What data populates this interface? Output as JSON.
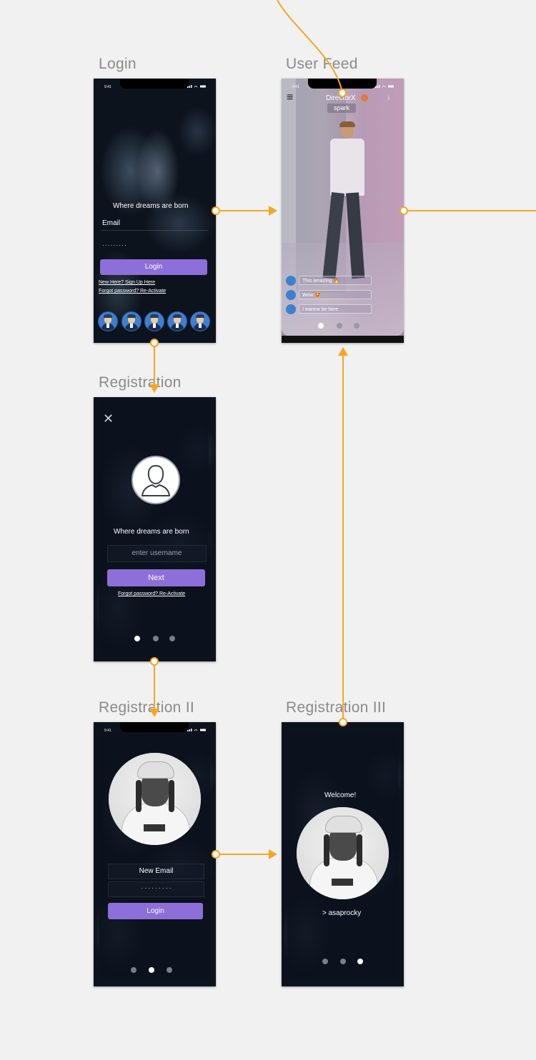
{
  "artboards": {
    "login": {
      "title": "Login",
      "status_time": "9:41",
      "tagline": "Where dreams are born",
      "email_label": "Email",
      "password_mask": "· · · · · · · · ·",
      "login_button": "Login",
      "signup_link": "New Here? Sign Up Here",
      "forgot_link": "Forgot password? Re-Activate"
    },
    "feed": {
      "title": "User Feed",
      "status_time": "9:41",
      "menu_icon": "≡",
      "username": "DirectorX",
      "spark_label": "spark",
      "info_icon": "i",
      "comments": [
        {
          "text": "This amazing 🔥"
        },
        {
          "text": "Wow 🤩"
        },
        {
          "text": "I wanna be here"
        }
      ]
    },
    "registration": {
      "title": "Registration",
      "close_icon": "✕",
      "tagline": "Where dreams are born",
      "username_placeholder": "enter username",
      "next_button": "Next",
      "forgot_link": "Forgot password? Re-Activate"
    },
    "registration2": {
      "title": "Registration II",
      "status_time": "9:41",
      "email_placeholder": "New Email",
      "password_mask": "· · · · · · · · ·",
      "login_button": "Login"
    },
    "registration3": {
      "title": "Registration III",
      "welcome": "Welcome!",
      "handle": "> asaprocky"
    }
  },
  "colors": {
    "background": "#f1f1f1",
    "connector": "#f5a623",
    "button": "#8c6fd9",
    "screen_dark": "#0d131d"
  }
}
